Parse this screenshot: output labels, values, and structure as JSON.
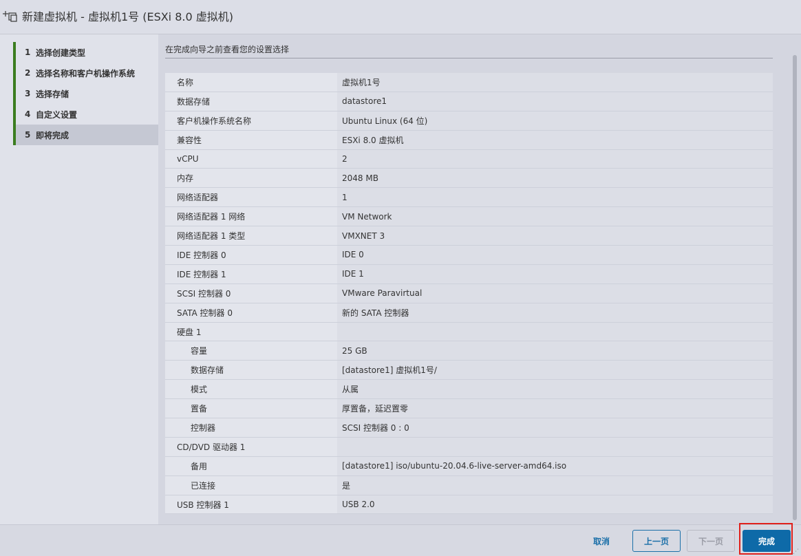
{
  "window": {
    "title": "新建虚拟机 - 虚拟机1号 (ESXi 8.0 虚拟机)",
    "icon": "add-vm-icon"
  },
  "steps": [
    {
      "num": "1",
      "label": "选择创建类型",
      "active": false
    },
    {
      "num": "2",
      "label": "选择名称和客户机操作系统",
      "active": false
    },
    {
      "num": "3",
      "label": "选择存储",
      "active": false
    },
    {
      "num": "4",
      "label": "自定义设置",
      "active": false
    },
    {
      "num": "5",
      "label": "即将完成",
      "active": true
    }
  ],
  "content": {
    "header": "在完成向导之前查看您的设置选择",
    "rows": [
      {
        "key": "名称",
        "value": "虚拟机1号",
        "sub": false
      },
      {
        "key": "数据存储",
        "value": "datastore1",
        "sub": false
      },
      {
        "key": "客户机操作系统名称",
        "value": "Ubuntu Linux (64 位)",
        "sub": false
      },
      {
        "key": "兼容性",
        "value": "ESXi 8.0 虚拟机",
        "sub": false
      },
      {
        "key": "vCPU",
        "value": "2",
        "sub": false
      },
      {
        "key": "内存",
        "value": "2048 MB",
        "sub": false
      },
      {
        "key": "网络适配器",
        "value": "1",
        "sub": false
      },
      {
        "key": "网络适配器 1 网络",
        "value": "VM Network",
        "sub": false
      },
      {
        "key": "网络适配器 1 类型",
        "value": "VMXNET 3",
        "sub": false
      },
      {
        "key": "IDE 控制器 0",
        "value": "IDE 0",
        "sub": false
      },
      {
        "key": "IDE 控制器 1",
        "value": "IDE 1",
        "sub": false
      },
      {
        "key": "SCSI 控制器 0",
        "value": "VMware Paravirtual",
        "sub": false
      },
      {
        "key": "SATA 控制器 0",
        "value": "新的 SATA 控制器",
        "sub": false
      },
      {
        "key": "硬盘 1",
        "value": "",
        "sub": false
      },
      {
        "key": "容量",
        "value": "25 GB",
        "sub": true
      },
      {
        "key": "数据存储",
        "value": "[datastore1] 虚拟机1号/",
        "sub": true
      },
      {
        "key": "模式",
        "value": "从属",
        "sub": true
      },
      {
        "key": "置备",
        "value": "厚置备，延迟置零",
        "sub": true
      },
      {
        "key": "控制器",
        "value": "SCSI 控制器 0 : 0",
        "sub": true
      },
      {
        "key": "CD/DVD 驱动器 1",
        "value": "",
        "sub": false
      },
      {
        "key": "备用",
        "value": "[datastore1] iso/ubuntu-20.04.6-live-server-amd64.iso",
        "sub": true
      },
      {
        "key": "已连接",
        "value": "是",
        "sub": true
      },
      {
        "key": "USB 控制器 1",
        "value": "USB 2.0",
        "sub": false
      }
    ]
  },
  "footer": {
    "cancel": "取消",
    "prev": "上一页",
    "next": "下一页",
    "finish": "完成"
  }
}
